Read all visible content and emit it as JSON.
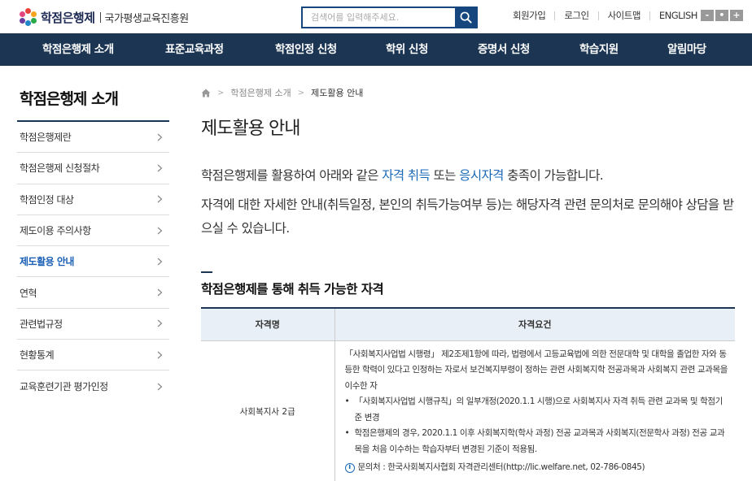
{
  "header": {
    "logo_text": "학점은행제",
    "org_name": "국가평생교육진흥원",
    "search_placeholder": "검색어를 입력해주세요.",
    "util_links": [
      "회원가입",
      "로그인",
      "사이트맵",
      "ENGLISH"
    ],
    "zoom": [
      "-",
      "•",
      "+"
    ]
  },
  "gnb": [
    "학점은행제 소개",
    "표준교육과정",
    "학점인정 신청",
    "학위 신청",
    "증명서 신청",
    "학습지원",
    "알림마당"
  ],
  "lnb": {
    "title": "학점은행제 소개",
    "items": [
      "학점은행제란",
      "학점은행제 신청절차",
      "학점인정 대상",
      "제도이용 주의사항",
      "제도활용 안내",
      "연혁",
      "관련법규정",
      "현황통계",
      "교육훈련기관 평가인정"
    ],
    "active_index": 4
  },
  "breadcrumb": {
    "parent": "학점은행제 소개",
    "current": "제도활용 안내"
  },
  "page_title": "제도활용 안내",
  "intro1": {
    "before": "학점은행제를 활용하여 아래와 같은 ",
    "hl1": "자격 취득",
    "mid": " 또는 ",
    "hl2": "응시자격",
    "after": " 충족이 가능합니다."
  },
  "intro2": "자격에 대한 자세한 안내(취득일정, 본인의 취득가능여부 등)는 해당자격 관련 문의처로 문의해야 상담을 받으실 수 있습니다.",
  "section_title": "학점은행제를 통해 취득 가능한 자격",
  "table": {
    "headers": [
      "자격명",
      "자격요건"
    ],
    "rows": [
      {
        "name": "사회복지사 2급",
        "req_main": "「사회복지사업법 시행령」 제2조제1항에 따라, 법령에서 고등교육법에 의한 전문대학 및 대학을 졸업한 자와 동등한 학력이 있다고 인정하는 자로서 보건복지부령이 정하는 관련 사회복지학 전공과목과 사회복지 관련 교과목을 이수한 자",
        "bullets": [
          "「사회복지사업법 시행규칙」의 일부개정(2020.1.1 시행)으로 사회복지사 자격 취득 관련 교과목 및 학점기준 변경",
          "학점은행제의 경우, 2020.1.1 이후 사회복지학(학사 과정) 전공 교과목과 사회복지(전문학사 과정) 전공 교과목을 처음 이수하는 학습자부터 변경된 기준이 적용됨."
        ],
        "info": "문의처 : 한국사회복지사협회 자격관리센터(http://lic.welfare.net, 02-786-0845)"
      }
    ]
  },
  "colors": {
    "navy": "#1b3553",
    "accent_blue": "#1b6ab8",
    "table_head_bg": "#e9eff6"
  }
}
